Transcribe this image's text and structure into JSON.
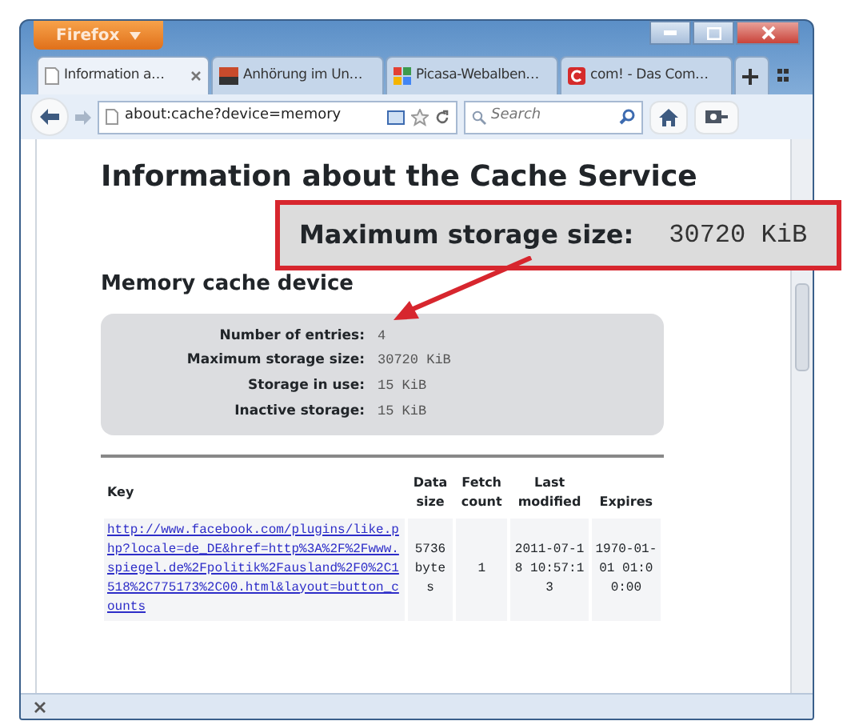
{
  "window": {
    "app_button": "Firefox"
  },
  "tabs": [
    {
      "label": "Information a…",
      "selected": true
    },
    {
      "label": "Anhörung im Un…",
      "selected": false
    },
    {
      "label": "Picasa-Webalben…",
      "selected": false
    },
    {
      "label": "com! - Das Com…",
      "selected": false
    }
  ],
  "address": {
    "value": "about:cache?device=memory"
  },
  "search": {
    "placeholder": "Search"
  },
  "page": {
    "title": "Information about the Cache Service",
    "section": "Memory cache device",
    "stats": [
      {
        "label": "Number of entries:",
        "value": "4"
      },
      {
        "label": "Maximum storage size:",
        "value": "30720 KiB"
      },
      {
        "label": "Storage in use:",
        "value": "15 KiB"
      },
      {
        "label": "Inactive storage:",
        "value": "15 KiB"
      }
    ],
    "table": {
      "columns": [
        "Key",
        "Data size",
        "Fetch count",
        "Last modified",
        "Expires"
      ],
      "rows": [
        {
          "key": "http://www.facebook.com/plugins/like.php?locale=de_DE&href=http%3A%2F%2Fwww.spiegel.de%2Fpolitik%2Fausland%2F0%2C1518%2C775173%2C00.html&layout=button_counts",
          "data_size": "5736 bytes",
          "fetch_count": "1",
          "last_modified": "2011-07-18 10:57:13",
          "expires": "1970-01-01 01:00:00"
        }
      ]
    }
  },
  "callout": {
    "label": "Maximum storage size:",
    "value": "30720 KiB"
  }
}
